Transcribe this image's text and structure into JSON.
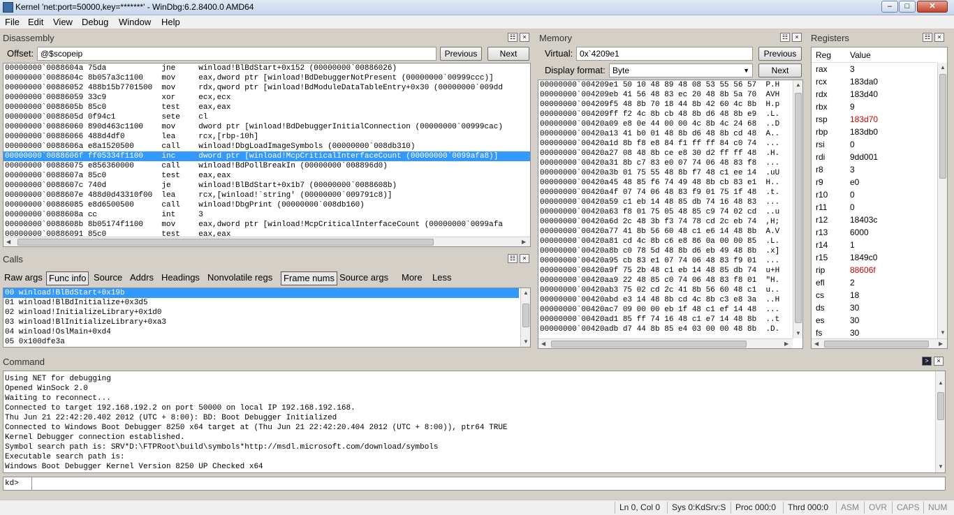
{
  "window": {
    "title": "Kernel 'net:port=50000,key=*******' - WinDbg:6.2.8400.0 AMD64"
  },
  "menu": [
    "File",
    "Edit",
    "View",
    "Debug",
    "Window",
    "Help"
  ],
  "disassembly": {
    "title": "Disassembly",
    "offset_label": "Offset:",
    "offset_value": "@$scopeip",
    "previous": "Previous",
    "next": "Next",
    "lines": [
      "00000000`0088604a 75da            jne     winload!BlBdStart+0x152 (00000000`00886026)",
      "00000000`0088604c 8b057a3c1100    mov     eax,dword ptr [winload!BdDebuggerNotPresent (00000000`00999ccc)]",
      "00000000`00886052 488b15b7701500  mov     rdx,qword ptr [winload!BdModuleDataTableEntry+0x30 (00000000`009dd",
      "00000000`00886059 33c9            xor     ecx,ecx",
      "00000000`0088605b 85c0            test    eax,eax",
      "00000000`0088605d 0f94c1          sete    cl",
      "00000000`00886060 890d463c1100    mov     dword ptr [winload!BdDebuggerInitialConnection (00000000`00999cac)",
      "00000000`00886066 488d4df0        lea     rcx,[rbp-10h]",
      "00000000`0088606a e8a1520500      call    winload!DbgLoadImageSymbols (00000000`008db310)",
      "00000000`0088606f ff05334f1100    inc     dword ptr [winload!McpCriticalInterfaceCount (00000000`0099afa8)]",
      "00000000`00886075 e856360000      call    winload!BdPollBreakIn (00000000`008896d0)",
      "00000000`0088607a 85c0            test    eax,eax",
      "00000000`0088607c 740d            je      winload!BlBdStart+0x1b7 (00000000`0088608b)",
      "00000000`0088607e 488d0d43310f00  lea     rcx,[winload!`string' (00000000`009791c8)]",
      "00000000`00886085 e8d6500500      call    winload!DbgPrint (00000000`008db160)",
      "00000000`0088608a cc              int     3",
      "00000000`0088608b 8b05174f1100    mov     eax,dword ptr [winload!McpCriticalInterfaceCount (00000000`0099afa",
      "00000000`00886091 85c0            test    eax,eax"
    ],
    "selected_index": 9
  },
  "calls": {
    "title": "Calls",
    "options": [
      "Raw args",
      "Func info",
      "Source",
      "Addrs",
      "Headings",
      "Nonvolatile regs",
      "Frame nums",
      "Source args",
      "More",
      "Less"
    ],
    "frames": [
      "00 winload!BlBdStart+0x19b",
      "01 winload!BlBdInitialize+0x3d5",
      "02 winload!InitializeLibrary+0x1d0",
      "03 winload!BlInitializeLibrary+0xa3",
      "04 winload!OslMain+0xd4",
      "05 0x100dfe3a"
    ]
  },
  "memory": {
    "title": "Memory",
    "virtual_label": "Virtual:",
    "virtual_value": "0x`4209e1",
    "display_label": "Display format:",
    "display_value": "Byte",
    "previous": "Previous",
    "next": "Next",
    "lines": [
      "00000000`004209e1 50 10 48 89 48 08 53 55 56 57  P.H",
      "00000000`004209eb 41 56 48 83 ec 20 48 8b 5a 70  AVH",
      "00000000`004209f5 48 8b 70 18 44 8b 42 60 4c 8b  H.p",
      "00000000`004209ff f2 4c 8b cb 48 8b d6 48 8b e9  .L.",
      "00000000`00420a09 e8 0e 44 00 00 4c 8b 4c 24 68  ..D",
      "00000000`00420a13 41 b0 01 48 8b d6 48 8b cd 48  A..",
      "00000000`00420a1d 8b f8 e8 84 f1 ff ff 84 c0 74  ...",
      "00000000`00420a27 08 48 8b ce e8 30 d2 ff ff 48  .H.",
      "00000000`00420a31 8b c7 83 e0 07 74 06 48 83 f8  ...",
      "00000000`00420a3b 01 75 55 48 8b f7 48 c1 ee 14  .uU",
      "00000000`00420a45 48 85 f6 74 49 48 8b cb 83 e1  H..",
      "00000000`00420a4f 07 74 06 48 83 f9 01 75 1f 48  .t.",
      "00000000`00420a59 c1 eb 14 48 85 db 74 16 48 83  ...",
      "00000000`00420a63 f8 01 75 05 48 85 c9 74 02 cd  ..u",
      "00000000`00420a6d 2c 48 3b f3 74 78 cd 2c eb 74  ,H;",
      "00000000`00420a77 41 8b 56 60 48 c1 e6 14 48 8b  A.V",
      "00000000`00420a81 cd 4c 8b c6 e8 86 0a 00 00 85  .L.",
      "00000000`00420a8b c0 78 5d 48 8b d6 eb 49 48 8b  .x]",
      "00000000`00420a95 cb 83 e1 07 74 06 48 83 f9 01  ...",
      "00000000`00420a9f 75 2b 48 c1 eb 14 48 85 db 74  u+H",
      "00000000`00420aa9 22 48 85 c0 74 06 48 83 f8 01  \"H.",
      "00000000`00420ab3 75 02 cd 2c 41 8b 56 60 48 c1  u..",
      "00000000`00420abd e3 14 48 8b cd 4c 8b c3 e8 3a  ..H",
      "00000000`00420ac7 09 00 00 eb 1f 48 c1 ef 14 48  ...",
      "00000000`00420ad1 85 ff 74 16 48 c1 e7 14 48 8b  ..t",
      "00000000`00420adb d7 44 8b 85 e4 03 00 00 48 8b  .D."
    ]
  },
  "registers": {
    "title": "Registers",
    "col_reg": "Reg",
    "col_value": "Value",
    "rows": [
      {
        "name": "rax",
        "value": "3",
        "changed": false
      },
      {
        "name": "rcx",
        "value": "183da0",
        "changed": false
      },
      {
        "name": "rdx",
        "value": "183d40",
        "changed": false
      },
      {
        "name": "rbx",
        "value": "9",
        "changed": false
      },
      {
        "name": "rsp",
        "value": "183d70",
        "changed": true
      },
      {
        "name": "rbp",
        "value": "183db0",
        "changed": false
      },
      {
        "name": "rsi",
        "value": "0",
        "changed": false
      },
      {
        "name": "rdi",
        "value": "9dd001",
        "changed": false
      },
      {
        "name": "r8",
        "value": "3",
        "changed": false
      },
      {
        "name": "r9",
        "value": "e0",
        "changed": false
      },
      {
        "name": "r10",
        "value": "0",
        "changed": false
      },
      {
        "name": "r11",
        "value": "0",
        "changed": false
      },
      {
        "name": "r12",
        "value": "18403c",
        "changed": false
      },
      {
        "name": "r13",
        "value": "6000",
        "changed": false
      },
      {
        "name": "r14",
        "value": "1",
        "changed": false
      },
      {
        "name": "r15",
        "value": "1849c0",
        "changed": false
      },
      {
        "name": "rip",
        "value": "88606f",
        "changed": true
      },
      {
        "name": "efl",
        "value": "2",
        "changed": false
      },
      {
        "name": "cs",
        "value": "18",
        "changed": false
      },
      {
        "name": "ds",
        "value": "30",
        "changed": false
      },
      {
        "name": "es",
        "value": "30",
        "changed": false
      },
      {
        "name": "fs",
        "value": "30",
        "changed": false
      }
    ]
  },
  "command": {
    "title": "Command",
    "lines": [
      "Using NET for debugging",
      "Opened WinSock 2.0",
      "Waiting to reconnect...",
      "Connected to target 192.168.192.2 on port 50000 on local IP 192.168.192.168.",
      "Thu Jun 21 22:42:20.402 2012 (UTC + 8:00): BD: Boot Debugger Initialized",
      "Connected to Windows Boot Debugger 8250 x64 target at (Thu Jun 21 22:42:20.404 2012 (UTC + 8:00)), ptr64 TRUE",
      "Kernel Debugger connection established.",
      "Symbol search path is: SRV*D:\\FTPRoot\\build\\symbols*http://msdl.microsoft.com/download/symbols",
      "Executable search path is:",
      "Windows Boot Debugger Kernel Version 8250 UP Checked x64"
    ],
    "prompt": "kd>",
    "input_value": ""
  },
  "status": {
    "position": "Ln 0, Col 0",
    "sys": "Sys 0:KdSrv:S",
    "proc": "Proc 000:0",
    "thrd": "Thrd 000:0",
    "asm": "ASM",
    "ovr": "OVR",
    "caps": "CAPS",
    "num": "NUM"
  }
}
